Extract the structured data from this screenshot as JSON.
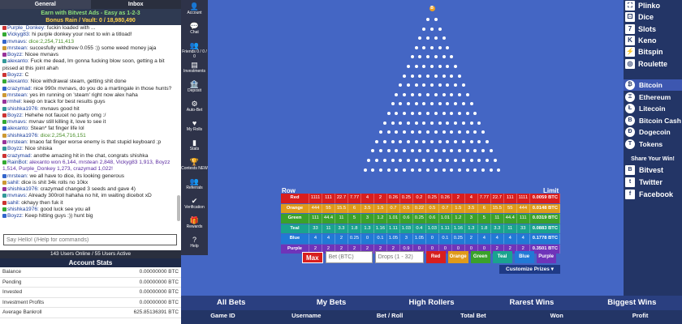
{
  "left": {
    "tabs": [
      "General",
      "Inbox"
    ],
    "earn_text": "Earn with Bitvest Ads - Easy as 1-2-3",
    "bonus_text": "Bonus Rain / Vault: 0 / 18,980,490",
    "messages": [
      {
        "user": "Purple_Donkey:",
        "text": " fuckin loaded with ..."
      },
      {
        "user": "Vickyg83:",
        "text": " hi purple donkey your next to win a titload!"
      },
      {
        "user": "mvnavs:",
        "text": " dice:2,254,711,413",
        "cls": "hl"
      },
      {
        "user": "mrstean:",
        "text": " succesfully withdrew 0.055 :)) some weed money jaja"
      },
      {
        "user": "Boyzz:",
        "text": " Nicee mvnavs"
      },
      {
        "user": "alexanto:",
        "text": " Fuck me dead, Im gonna fucking blow soon, getting a bit pissed at this joint ahah",
        "wrap": true
      },
      {
        "user": "Boyzz:",
        "text": " C"
      },
      {
        "user": "alexanto:",
        "text": " Nice withdrawal steam, getting shit done"
      },
      {
        "user": "crazymad:",
        "text": " nice 990x mvnavs, do you do a martingale in those hunts?"
      },
      {
        "user": "mrstean:",
        "text": " yes im running on 'steam' right now alex haha"
      },
      {
        "user": "rmhel:",
        "text": " keep on track for best results guys"
      },
      {
        "user": "shishka1976:",
        "text": " mvnavs good hit"
      },
      {
        "user": "Boyzz:",
        "text": " Hehehe not faucet no party omg :/"
      },
      {
        "user": "mvnavs:",
        "text": " mvnav still killing it, love to see it"
      },
      {
        "user": "alexanto:",
        "text": " Stean* fat finger life lol"
      },
      {
        "user": "shishka1976:",
        "text": " dice:2,254,716,151",
        "cls": "hl"
      },
      {
        "user": "mrstean:",
        "text": " lmaoo fat finger worse enemy is that stupid keyboard ;p"
      },
      {
        "user": "Boyzz:",
        "text": " Nice shiska"
      },
      {
        "user": "crazymad:",
        "text": " anothe amazing hit in the chat, congrats shishka"
      },
      {
        "user": "RainBot:",
        "text": " alexanto won 6,144, mrstean 2,848, Vickyg83 1,913, Boyzz 1,514, Purple_Donkey 1,273, crazymad 1,022!",
        "cls": "rb",
        "wrap": true
      },
      {
        "user": "mrstean:",
        "text": " we all have to dice, its looking generous"
      },
      {
        "user": "sahil:",
        "text": " dice is shit 34k rolls no 10kx"
      },
      {
        "user": "shishka1976:",
        "text": " crazymad changed 3 seeds and gave 4)"
      },
      {
        "user": "mvnavs:",
        "text": " Already 300roll hahaha no hit, im waiting dicebot xD"
      },
      {
        "user": "sahil:",
        "text": " okhayy then fuk it"
      },
      {
        "user": "shishka1976:",
        "text": " good luck see you all"
      },
      {
        "user": "Boyzz:",
        "text": " Keep hitting guys :)) hunt big"
      }
    ],
    "chat_placeholder": "Say Hello! (/Help for commands)",
    "online": "143 Users Online / 55 Users Active",
    "account_title": "Account Stats",
    "stats": [
      {
        "label": "Balance",
        "value": "0.00000000 BTC"
      },
      {
        "label": "Pending",
        "value": "0.00000000 BTC"
      },
      {
        "label": "Invested",
        "value": "0.00000000 BTC"
      },
      {
        "label": "Investment Profits",
        "value": "0.00000000 BTC"
      },
      {
        "label": "Average Bankroll",
        "value": "625.85136391 BTC"
      }
    ]
  },
  "menu": [
    {
      "icon": "👤",
      "label": "Account"
    },
    {
      "icon": "💬",
      "label": "Chat"
    },
    {
      "icon": "👥",
      "label": "Friends 0 / 0 / 0"
    },
    {
      "icon": "▤",
      "label": "Investments"
    },
    {
      "icon": "🏦",
      "label": "Deposit"
    },
    {
      "icon": "⚙",
      "label": "Auto-Bet"
    },
    {
      "icon": "♥",
      "label": "My Rolls"
    },
    {
      "icon": "▮",
      "label": "Stats"
    },
    {
      "icon": "🏆",
      "label": "Contests NEW"
    },
    {
      "icon": "👥",
      "label": "Referrals"
    },
    {
      "icon": "✔",
      "label": "Verification"
    },
    {
      "icon": "🎁",
      "label": "Rewards"
    },
    {
      "icon": "?",
      "label": "Help"
    }
  ],
  "board": {
    "row_label": "Row",
    "limit_label": "Limit",
    "ball_label": "B",
    "rows": [
      {
        "name": "Red",
        "color": "#d81e1e",
        "values": [
          "1111",
          "111",
          "22.7",
          "7.77",
          "4",
          "2",
          "0.26",
          "0.25",
          "0.2",
          "0.25",
          "0.26",
          "2",
          "4",
          "7.77",
          "22.7",
          "111",
          "1111"
        ],
        "limit": "0.0059 BTC"
      },
      {
        "name": "Orange",
        "color": "#e09a1a",
        "values": [
          "444",
          "55",
          "15.5",
          "6",
          "3.5",
          "1.5",
          "0.7",
          "0.5",
          "0.22",
          "0.5",
          "0.7",
          "1.5",
          "3.5",
          "6",
          "15.5",
          "55",
          "444"
        ],
        "limit": "0.0148 BTC"
      },
      {
        "name": "Green",
        "color": "#3aa12b",
        "values": [
          "111",
          "44.4",
          "11",
          "5",
          "3",
          "1.2",
          "1.01",
          "0.6",
          "0.25",
          "0.6",
          "1.01",
          "1.2",
          "3",
          "5",
          "11",
          "44.4",
          "111"
        ],
        "limit": "0.0319 BTC"
      },
      {
        "name": "Teal",
        "color": "#1aa38f",
        "values": [
          "33",
          "11",
          "3.3",
          "1.8",
          "1.3",
          "1.16",
          "1.11",
          "1.03",
          "0.4",
          "1.03",
          "1.11",
          "1.16",
          "1.3",
          "1.8",
          "3.3",
          "11",
          "33"
        ],
        "limit": "0.0883 BTC"
      },
      {
        "name": "Blue",
        "color": "#2279d6",
        "values": [
          "4",
          "4",
          "2",
          "0.25",
          "0",
          "0.1",
          "1.05",
          "3",
          "1.05",
          "0",
          "0.1",
          "0.25",
          "2",
          "4",
          "4",
          "4",
          "4"
        ],
        "limit": "0.1778 BTC"
      },
      {
        "name": "Purple",
        "color": "#6f34b9",
        "values": [
          "2",
          "2",
          "2",
          "2",
          "2",
          "2",
          "2",
          "0.9",
          "0",
          "0",
          "0",
          "0",
          "0",
          "0",
          "2",
          "2",
          "2"
        ],
        "limit": "0.3501 BTC"
      }
    ],
    "controls": {
      "max_label": "Max",
      "bet_placeholder": "Bet (BTC)",
      "drops_placeholder": "Drops (1 - 32)",
      "buttons": [
        {
          "label": "Red",
          "color": "#d81e1e"
        },
        {
          "label": "Orange",
          "color": "#e09a1a"
        },
        {
          "label": "Green",
          "color": "#3aa12b"
        },
        {
          "label": "Teal",
          "color": "#1aa38f"
        },
        {
          "label": "Blue",
          "color": "#2279d6"
        },
        {
          "label": "Purple",
          "color": "#6f34b9"
        }
      ],
      "customize_label": "Customize Prizes ▾"
    }
  },
  "right": {
    "games": [
      {
        "icon": "⛶",
        "label": "Plinko"
      },
      {
        "icon": "⚀",
        "label": "Dice"
      },
      {
        "icon": "7",
        "label": "Slots"
      },
      {
        "icon": "K",
        "label": "Keno"
      },
      {
        "icon": "⚡",
        "label": "Bitspin"
      },
      {
        "icon": "◎",
        "label": "Roulette"
      }
    ],
    "coins": [
      {
        "icon": "₿",
        "label": "Bitcoin",
        "sel": true
      },
      {
        "icon": "Ξ",
        "label": "Ethereum"
      },
      {
        "icon": "Ł",
        "label": "Litecoin"
      },
      {
        "icon": "B",
        "label": "Bitcoin Cash"
      },
      {
        "icon": "Ð",
        "label": "Dogecoin"
      },
      {
        "icon": "T",
        "label": "Tokens"
      }
    ],
    "share_title": "Share Your Win!",
    "shares": [
      {
        "icon": "B",
        "label": "Bitvest"
      },
      {
        "icon": "t",
        "label": "Twitter"
      },
      {
        "icon": "f",
        "label": "Facebook"
      }
    ]
  },
  "bets": {
    "tabs": [
      "All Bets",
      "My Bets",
      "High Rollers",
      "Rarest Wins",
      "Biggest Wins"
    ],
    "columns": [
      "Game ID",
      "Username",
      "Bet / Roll",
      "Total Bet",
      "Won",
      "Profit"
    ]
  }
}
